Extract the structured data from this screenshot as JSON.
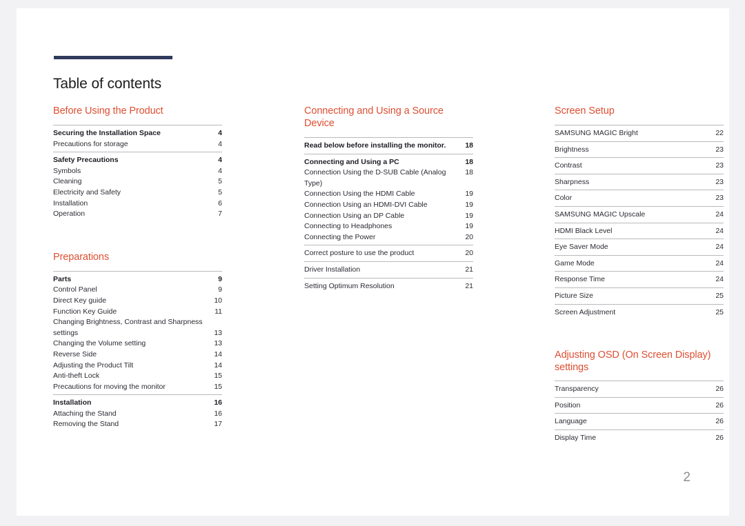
{
  "document": {
    "title": "Table of contents",
    "folio": "2",
    "accent_color": "#dd4f32",
    "rule_color": "#2f3a5c",
    "page_bg": "#ffffff",
    "canvas_bg": "#f2f2f4"
  },
  "columns": [
    {
      "name": "column-left",
      "sections": [
        {
          "heading": "Before Using the Product",
          "groups": [
            {
              "entries": [
                {
                  "label": "Securing the Installation Space",
                  "page": "4",
                  "bold": true
                },
                {
                  "label": "Precautions for storage",
                  "page": "4",
                  "bold": false
                }
              ]
            },
            {
              "entries": [
                {
                  "label": "Safety Precautions",
                  "page": "4",
                  "bold": true
                },
                {
                  "label": "Symbols",
                  "page": "4",
                  "bold": false
                },
                {
                  "label": "Cleaning",
                  "page": "5",
                  "bold": false
                },
                {
                  "label": "Electricity and Safety",
                  "page": "5",
                  "bold": false
                },
                {
                  "label": "Installation",
                  "page": "6",
                  "bold": false
                },
                {
                  "label": "Operation",
                  "page": "7",
                  "bold": false
                }
              ]
            }
          ]
        },
        {
          "heading": "Preparations",
          "groups": [
            {
              "entries": [
                {
                  "label": "Parts",
                  "page": "9",
                  "bold": true
                },
                {
                  "label": "Control Panel",
                  "page": "9",
                  "bold": false
                },
                {
                  "label": "Direct Key guide",
                  "page": "10",
                  "bold": false
                },
                {
                  "label": "Function Key Guide",
                  "page": "11",
                  "bold": false
                },
                {
                  "label": "Changing Brightness, Contrast and Sharpness settings",
                  "page": "13",
                  "bold": false,
                  "wrapped": true
                },
                {
                  "label": "Changing the Volume setting",
                  "page": "13",
                  "bold": false
                },
                {
                  "label": "Reverse Side",
                  "page": "14",
                  "bold": false
                },
                {
                  "label": "Adjusting the Product Tilt",
                  "page": "14",
                  "bold": false
                },
                {
                  "label": "Anti-theft Lock",
                  "page": "15",
                  "bold": false
                },
                {
                  "label": "Precautions for moving the monitor",
                  "page": "15",
                  "bold": false
                }
              ]
            },
            {
              "entries": [
                {
                  "label": "Installation",
                  "page": "16",
                  "bold": true
                },
                {
                  "label": "Attaching the Stand",
                  "page": "16",
                  "bold": false
                },
                {
                  "label": "Removing the Stand",
                  "page": "17",
                  "bold": false
                }
              ]
            }
          ]
        }
      ]
    },
    {
      "name": "column-middle",
      "sections": [
        {
          "heading": "Connecting and Using a Source Device",
          "groups": [
            {
              "entries": [
                {
                  "label": "Read below before installing the monitor.",
                  "page": "18",
                  "bold": true
                }
              ]
            },
            {
              "entries": [
                {
                  "label": "Connecting and Using a PC",
                  "page": "18",
                  "bold": true
                },
                {
                  "label": "Connection Using the D-SUB Cable (Analog Type)",
                  "page": "18",
                  "bold": false
                },
                {
                  "label": "Connection Using the HDMI Cable",
                  "page": "19",
                  "bold": false
                },
                {
                  "label": "Connection Using an HDMI-DVI Cable",
                  "page": "19",
                  "bold": false
                },
                {
                  "label": "Connection Using an DP Cable",
                  "page": "19",
                  "bold": false
                },
                {
                  "label": "Connecting to Headphones",
                  "page": "19",
                  "bold": false
                },
                {
                  "label": "Connecting the Power",
                  "page": "20",
                  "bold": false
                }
              ]
            },
            {
              "entries": [
                {
                  "label": "Correct posture to use the product",
                  "page": "20",
                  "bold": false
                }
              ]
            },
            {
              "entries": [
                {
                  "label": "Driver Installation",
                  "page": "21",
                  "bold": false
                }
              ]
            },
            {
              "entries": [
                {
                  "label": "Setting Optimum Resolution",
                  "page": "21",
                  "bold": false
                }
              ]
            }
          ]
        }
      ]
    },
    {
      "name": "column-right",
      "sections": [
        {
          "heading": "Screen Setup",
          "groups": [
            {
              "entries": [
                {
                  "label": "SAMSUNG MAGIC Bright",
                  "page": "22",
                  "bold": false
                }
              ]
            },
            {
              "entries": [
                {
                  "label": "Brightness",
                  "page": "23",
                  "bold": false
                }
              ]
            },
            {
              "entries": [
                {
                  "label": "Contrast",
                  "page": "23",
                  "bold": false
                }
              ]
            },
            {
              "entries": [
                {
                  "label": "Sharpness",
                  "page": "23",
                  "bold": false
                }
              ]
            },
            {
              "entries": [
                {
                  "label": "Color",
                  "page": "23",
                  "bold": false
                }
              ]
            },
            {
              "entries": [
                {
                  "label": "SAMSUNG MAGIC Upscale",
                  "page": "24",
                  "bold": false
                }
              ]
            },
            {
              "entries": [
                {
                  "label": "HDMI Black Level",
                  "page": "24",
                  "bold": false
                }
              ]
            },
            {
              "entries": [
                {
                  "label": "Eye Saver Mode",
                  "page": "24",
                  "bold": false
                }
              ]
            },
            {
              "entries": [
                {
                  "label": "Game Mode",
                  "page": "24",
                  "bold": false
                }
              ]
            },
            {
              "entries": [
                {
                  "label": "Response Time",
                  "page": "24",
                  "bold": false
                }
              ]
            },
            {
              "entries": [
                {
                  "label": "Picture Size",
                  "page": "25",
                  "bold": false
                }
              ]
            },
            {
              "entries": [
                {
                  "label": "Screen Adjustment",
                  "page": "25",
                  "bold": false
                }
              ]
            }
          ]
        },
        {
          "heading": "Adjusting OSD (On Screen Display) settings",
          "two_line": true,
          "groups": [
            {
              "entries": [
                {
                  "label": "Transparency",
                  "page": "26",
                  "bold": false
                }
              ]
            },
            {
              "entries": [
                {
                  "label": "Position",
                  "page": "26",
                  "bold": false
                }
              ]
            },
            {
              "entries": [
                {
                  "label": "Language",
                  "page": "26",
                  "bold": false
                }
              ]
            },
            {
              "entries": [
                {
                  "label": "Display Time",
                  "page": "26",
                  "bold": false
                }
              ]
            }
          ]
        }
      ]
    }
  ]
}
